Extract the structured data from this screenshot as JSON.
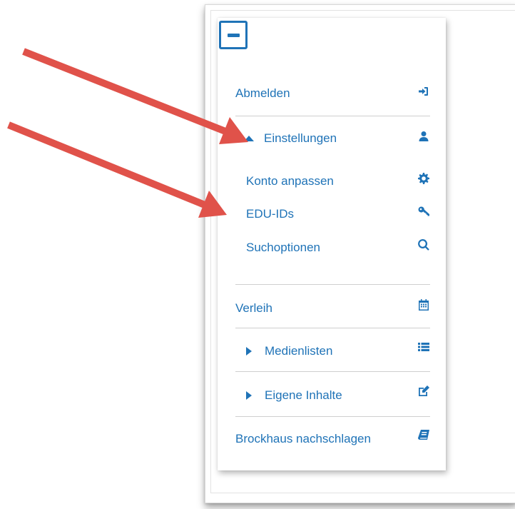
{
  "menu": {
    "logout": {
      "label": "Abmelden",
      "icon": "sign-in-icon"
    },
    "settings": {
      "label": "Einstellungen",
      "icon": "user-icon",
      "expanded": true,
      "children": [
        {
          "label": "Konto anpassen",
          "icon": "gear-icon"
        },
        {
          "label": "EDU-IDs",
          "icon": "key-icon"
        },
        {
          "label": "Suchoptionen",
          "icon": "search-icon"
        }
      ]
    },
    "lending": {
      "label": "Verleih",
      "icon": "calendar-icon"
    },
    "media_lists": {
      "label": "Medienlisten",
      "icon": "list-icon",
      "expanded": false
    },
    "own_content": {
      "label": "Eigene Inhalte",
      "icon": "edit-icon",
      "expanded": false
    },
    "brockhaus": {
      "label": "Brockhaus nachschlagen",
      "icon": "book-icon"
    }
  },
  "colors": {
    "accent": "#1f73b7",
    "divider": "#cfcfcf",
    "annotation_arrow": "#e0524a"
  }
}
